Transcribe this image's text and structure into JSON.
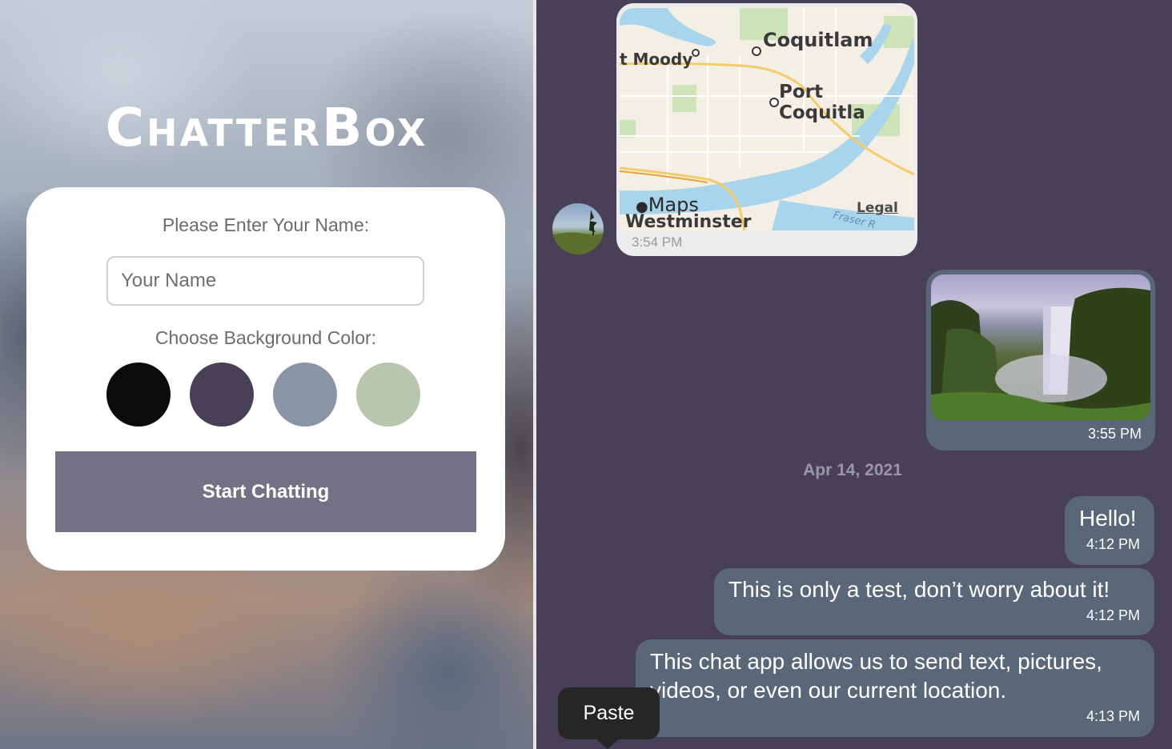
{
  "start_screen": {
    "app_title": "ChatterBox",
    "name_label": "Please Enter Your Name:",
    "name_placeholder": "Your Name",
    "color_label": "Choose Background Color:",
    "color_options": [
      "#090C08",
      "#474056",
      "#8A95A5",
      "#B9C6AE"
    ],
    "start_button": "Start Chatting"
  },
  "chat": {
    "background_color": "#474056",
    "bubble_color": "#5A6779",
    "map_message": {
      "time": "3:54 PM",
      "places": [
        "t Moody",
        "Coquitlam",
        "Port Coquitla",
        "Westminster"
      ],
      "provider": "Maps",
      "legal": "Legal",
      "river": "Fraser R"
    },
    "image_message": {
      "time": "3:55 PM"
    },
    "date_separator": "Apr 14, 2021",
    "messages": [
      {
        "text": "Hello!",
        "time": "4:12 PM"
      },
      {
        "text": "This is only a test, don’t worry about it!",
        "time": "4:12 PM"
      },
      {
        "text": "This chat app allows us to send text, pictures, videos, or even our current location.",
        "time": "4:13 PM"
      }
    ],
    "context_menu": {
      "paste": "Paste"
    }
  }
}
